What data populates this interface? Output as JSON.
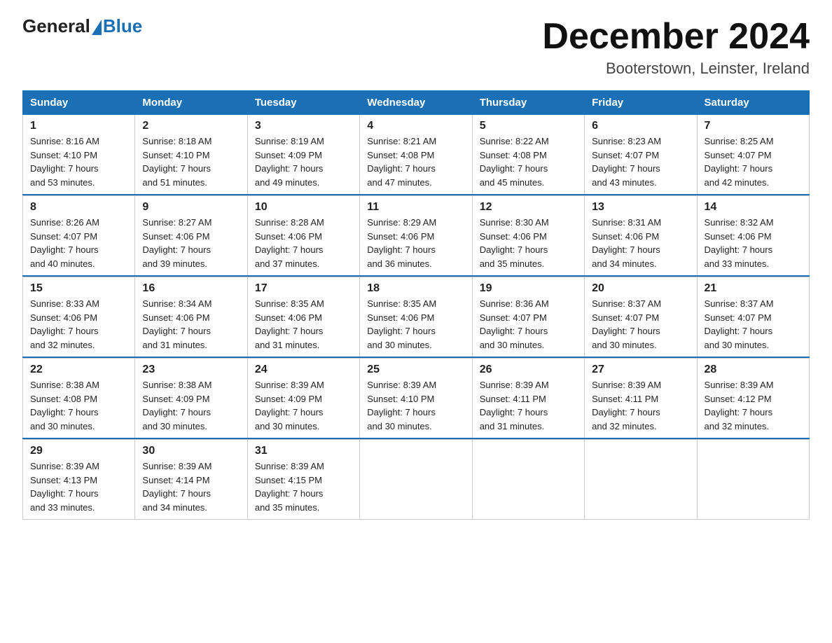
{
  "logo": {
    "general": "General",
    "blue": "Blue"
  },
  "header": {
    "month": "December 2024",
    "location": "Booterstown, Leinster, Ireland"
  },
  "days_of_week": [
    "Sunday",
    "Monday",
    "Tuesday",
    "Wednesday",
    "Thursday",
    "Friday",
    "Saturday"
  ],
  "weeks": [
    [
      {
        "day": "1",
        "sunrise": "8:16 AM",
        "sunset": "4:10 PM",
        "daylight": "7 hours and 53 minutes."
      },
      {
        "day": "2",
        "sunrise": "8:18 AM",
        "sunset": "4:10 PM",
        "daylight": "7 hours and 51 minutes."
      },
      {
        "day": "3",
        "sunrise": "8:19 AM",
        "sunset": "4:09 PM",
        "daylight": "7 hours and 49 minutes."
      },
      {
        "day": "4",
        "sunrise": "8:21 AM",
        "sunset": "4:08 PM",
        "daylight": "7 hours and 47 minutes."
      },
      {
        "day": "5",
        "sunrise": "8:22 AM",
        "sunset": "4:08 PM",
        "daylight": "7 hours and 45 minutes."
      },
      {
        "day": "6",
        "sunrise": "8:23 AM",
        "sunset": "4:07 PM",
        "daylight": "7 hours and 43 minutes."
      },
      {
        "day": "7",
        "sunrise": "8:25 AM",
        "sunset": "4:07 PM",
        "daylight": "7 hours and 42 minutes."
      }
    ],
    [
      {
        "day": "8",
        "sunrise": "8:26 AM",
        "sunset": "4:07 PM",
        "daylight": "7 hours and 40 minutes."
      },
      {
        "day": "9",
        "sunrise": "8:27 AM",
        "sunset": "4:06 PM",
        "daylight": "7 hours and 39 minutes."
      },
      {
        "day": "10",
        "sunrise": "8:28 AM",
        "sunset": "4:06 PM",
        "daylight": "7 hours and 37 minutes."
      },
      {
        "day": "11",
        "sunrise": "8:29 AM",
        "sunset": "4:06 PM",
        "daylight": "7 hours and 36 minutes."
      },
      {
        "day": "12",
        "sunrise": "8:30 AM",
        "sunset": "4:06 PM",
        "daylight": "7 hours and 35 minutes."
      },
      {
        "day": "13",
        "sunrise": "8:31 AM",
        "sunset": "4:06 PM",
        "daylight": "7 hours and 34 minutes."
      },
      {
        "day": "14",
        "sunrise": "8:32 AM",
        "sunset": "4:06 PM",
        "daylight": "7 hours and 33 minutes."
      }
    ],
    [
      {
        "day": "15",
        "sunrise": "8:33 AM",
        "sunset": "4:06 PM",
        "daylight": "7 hours and 32 minutes."
      },
      {
        "day": "16",
        "sunrise": "8:34 AM",
        "sunset": "4:06 PM",
        "daylight": "7 hours and 31 minutes."
      },
      {
        "day": "17",
        "sunrise": "8:35 AM",
        "sunset": "4:06 PM",
        "daylight": "7 hours and 31 minutes."
      },
      {
        "day": "18",
        "sunrise": "8:35 AM",
        "sunset": "4:06 PM",
        "daylight": "7 hours and 30 minutes."
      },
      {
        "day": "19",
        "sunrise": "8:36 AM",
        "sunset": "4:07 PM",
        "daylight": "7 hours and 30 minutes."
      },
      {
        "day": "20",
        "sunrise": "8:37 AM",
        "sunset": "4:07 PM",
        "daylight": "7 hours and 30 minutes."
      },
      {
        "day": "21",
        "sunrise": "8:37 AM",
        "sunset": "4:07 PM",
        "daylight": "7 hours and 30 minutes."
      }
    ],
    [
      {
        "day": "22",
        "sunrise": "8:38 AM",
        "sunset": "4:08 PM",
        "daylight": "7 hours and 30 minutes."
      },
      {
        "day": "23",
        "sunrise": "8:38 AM",
        "sunset": "4:09 PM",
        "daylight": "7 hours and 30 minutes."
      },
      {
        "day": "24",
        "sunrise": "8:39 AM",
        "sunset": "4:09 PM",
        "daylight": "7 hours and 30 minutes."
      },
      {
        "day": "25",
        "sunrise": "8:39 AM",
        "sunset": "4:10 PM",
        "daylight": "7 hours and 30 minutes."
      },
      {
        "day": "26",
        "sunrise": "8:39 AM",
        "sunset": "4:11 PM",
        "daylight": "7 hours and 31 minutes."
      },
      {
        "day": "27",
        "sunrise": "8:39 AM",
        "sunset": "4:11 PM",
        "daylight": "7 hours and 32 minutes."
      },
      {
        "day": "28",
        "sunrise": "8:39 AM",
        "sunset": "4:12 PM",
        "daylight": "7 hours and 32 minutes."
      }
    ],
    [
      {
        "day": "29",
        "sunrise": "8:39 AM",
        "sunset": "4:13 PM",
        "daylight": "7 hours and 33 minutes."
      },
      {
        "day": "30",
        "sunrise": "8:39 AM",
        "sunset": "4:14 PM",
        "daylight": "7 hours and 34 minutes."
      },
      {
        "day": "31",
        "sunrise": "8:39 AM",
        "sunset": "4:15 PM",
        "daylight": "7 hours and 35 minutes."
      },
      null,
      null,
      null,
      null
    ]
  ],
  "labels": {
    "sunrise": "Sunrise:",
    "sunset": "Sunset:",
    "daylight": "Daylight:"
  }
}
